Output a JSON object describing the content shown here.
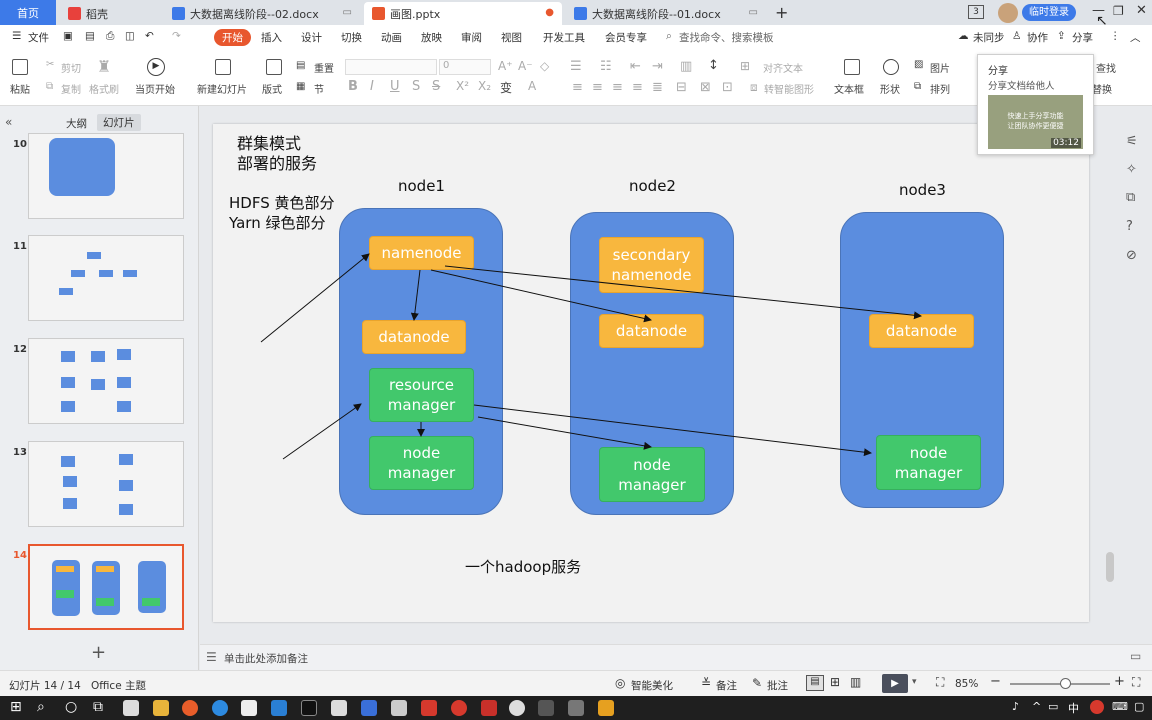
{
  "tabs": [
    {
      "label": "首页"
    },
    {
      "label": "稻壳"
    },
    {
      "label": "大数据离线阶段--02.docx"
    },
    {
      "label": "画图.pptx"
    },
    {
      "label": "大数据离线阶段--01.docx"
    }
  ],
  "tabbar": {
    "new_tab": "+",
    "badge": "3",
    "login": "临时登录"
  },
  "menu": {
    "file": "文件",
    "items": [
      "开始",
      "插入",
      "设计",
      "切换",
      "动画",
      "放映",
      "审阅",
      "视图",
      "开发工具",
      "会员专享"
    ],
    "search": "查找命令、搜索模板",
    "sync": "未同步",
    "collab": "协作",
    "share": "分享"
  },
  "toolbar": {
    "paste": "粘贴",
    "cut": "剪切",
    "copy": "复制",
    "format_painter": "格式刷",
    "play_current": "当页开始",
    "new_slide": "新建幻灯片",
    "layout": "版式",
    "reset": "重置",
    "section": "节",
    "font_size": "0",
    "align_text": "对齐文本",
    "convert_smartart": "转智能图形",
    "textbox": "文本框",
    "shape": "形状",
    "picture": "图片",
    "arrange": "排列",
    "find": "查找",
    "replace": "替换"
  },
  "share_popup": {
    "title": "分享",
    "subtitle": "分享文档给他人",
    "video_text1": "快速上手分享功能",
    "video_text2": "让团队协作更便捷",
    "duration": "03:12"
  },
  "panel": {
    "tab_outline": "大纲",
    "tab_slides": "幻灯片",
    "add": "+"
  },
  "thumbnails": [
    {
      "num": "10"
    },
    {
      "num": "11"
    },
    {
      "num": "12"
    },
    {
      "num": "13"
    },
    {
      "num": "14"
    }
  ],
  "slide": {
    "title_line1": "群集模式",
    "title_line2": "部署的服务",
    "legend_line1": "HDFS 黄色部分",
    "legend_line2": "Yarn 绿色部分",
    "footer": "一个hadoop服务",
    "nodes": [
      {
        "label": "node1"
      },
      {
        "label": "node2"
      },
      {
        "label": "node3"
      }
    ],
    "boxes": {
      "namenode": "namenode",
      "datanode1": "datanode",
      "rm_line1": "resource",
      "rm_line2": "manager",
      "nm1_line1": "node",
      "nm1_line2": "manager",
      "snn_line1": "secondary",
      "snn_line2": "namenode",
      "datanode2": "datanode",
      "nm2_line1": "node",
      "nm2_line2": "manager",
      "datanode3": "datanode",
      "nm3_line1": "node",
      "nm3_line2": "manager"
    },
    "colors": {
      "node": "#5b8ddf",
      "hdfs": "#f8b73e",
      "yarn": "#42c86c"
    }
  },
  "notes_placeholder": "单击此处添加备注",
  "status": {
    "slide_count": "幻灯片 14 / 14",
    "theme": "Office 主题",
    "beautify": "智能美化",
    "notes": "备注",
    "comments": "批注",
    "zoom": "85%",
    "zoom_fraction": 0.55
  },
  "taskbar": {
    "time": "中"
  }
}
